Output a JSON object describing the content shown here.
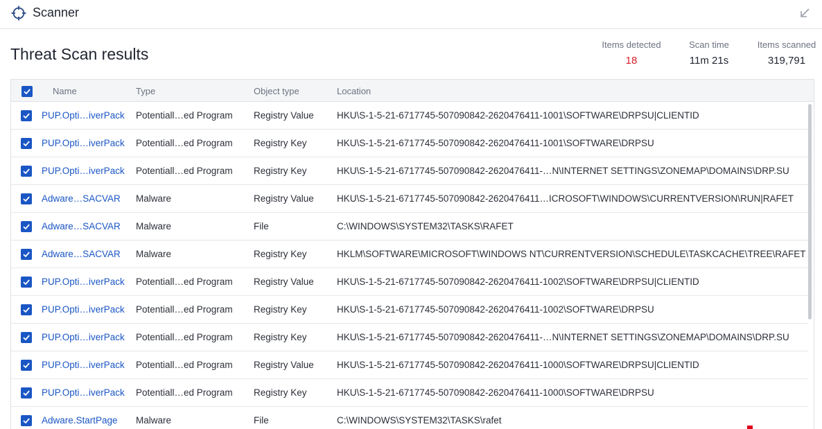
{
  "header": {
    "app_title": "Scanner",
    "app_icon": "crosshair-icon",
    "collapse_icon": "arrow-down-left-icon"
  },
  "page_title": "Threat Scan results",
  "stats": [
    {
      "label": "Items detected",
      "value": "18",
      "color": "#d91e2a"
    },
    {
      "label": "Scan time",
      "value": "11m 21s"
    },
    {
      "label": "Items scanned",
      "value": "319,791"
    }
  ],
  "table": {
    "columns": [
      "Name",
      "Type",
      "Object type",
      "Location"
    ],
    "header_checked": true,
    "rows": [
      {
        "checked": true,
        "name": "PUP.Opti…iverPack",
        "type": "Potentiall…ed Program",
        "object_type": "Registry Value",
        "location": "HKU\\S-1-5-21-6717745-507090842-2620476411-1001\\SOFTWARE\\DRPSU|CLIENTID"
      },
      {
        "checked": true,
        "name": "PUP.Opti…iverPack",
        "type": "Potentiall…ed Program",
        "object_type": "Registry Key",
        "location": "HKU\\S-1-5-21-6717745-507090842-2620476411-1001\\SOFTWARE\\DRPSU"
      },
      {
        "checked": true,
        "name": "PUP.Opti…iverPack",
        "type": "Potentiall…ed Program",
        "object_type": "Registry Key",
        "location": "HKU\\S-1-5-21-6717745-507090842-2620476411-…N\\INTERNET SETTINGS\\ZONEMAP\\DOMAINS\\DRP.SU"
      },
      {
        "checked": true,
        "name": "Adware…SACVAR",
        "type": "Malware",
        "object_type": "Registry Value",
        "location": "HKU\\S-1-5-21-6717745-507090842-2620476411…ICROSOFT\\WINDOWS\\CURRENTVERSION\\RUN|RAFET"
      },
      {
        "checked": true,
        "name": "Adware…SACVAR",
        "type": "Malware",
        "object_type": "File",
        "location": "C:\\WINDOWS\\SYSTEM32\\TASKS\\RAFET"
      },
      {
        "checked": true,
        "name": "Adware…SACVAR",
        "type": "Malware",
        "object_type": "Registry Key",
        "location": "HKLM\\SOFTWARE\\MICROSOFT\\WINDOWS NT\\CURRENTVERSION\\SCHEDULE\\TASKCACHE\\TREE\\RAFET"
      },
      {
        "checked": true,
        "name": "PUP.Opti…iverPack",
        "type": "Potentiall…ed Program",
        "object_type": "Registry Value",
        "location": "HKU\\S-1-5-21-6717745-507090842-2620476411-1002\\SOFTWARE\\DRPSU|CLIENTID"
      },
      {
        "checked": true,
        "name": "PUP.Opti…iverPack",
        "type": "Potentiall…ed Program",
        "object_type": "Registry Key",
        "location": "HKU\\S-1-5-21-6717745-507090842-2620476411-1002\\SOFTWARE\\DRPSU"
      },
      {
        "checked": true,
        "name": "PUP.Opti…iverPack",
        "type": "Potentiall…ed Program",
        "object_type": "Registry Key",
        "location": "HKU\\S-1-5-21-6717745-507090842-2620476411-…N\\INTERNET SETTINGS\\ZONEMAP\\DOMAINS\\DRP.SU"
      },
      {
        "checked": true,
        "name": "PUP.Opti…iverPack",
        "type": "Potentiall…ed Program",
        "object_type": "Registry Value",
        "location": "HKU\\S-1-5-21-6717745-507090842-2620476411-1000\\SOFTWARE\\DRPSU|CLIENTID"
      },
      {
        "checked": true,
        "name": "PUP.Opti…iverPack",
        "type": "Potentiall…ed Program",
        "object_type": "Registry Key",
        "location": "HKU\\S-1-5-21-6717745-507090842-2620476411-1000\\SOFTWARE\\DRPSU"
      },
      {
        "checked": true,
        "name": "Adware.StartPage",
        "type": "Malware",
        "object_type": "File",
        "location": "C:\\WINDOWS\\SYSTEM32\\TASKS\\rafet"
      }
    ]
  },
  "colors": {
    "accent": "#1a56c4",
    "alert": "#d91e2a"
  }
}
